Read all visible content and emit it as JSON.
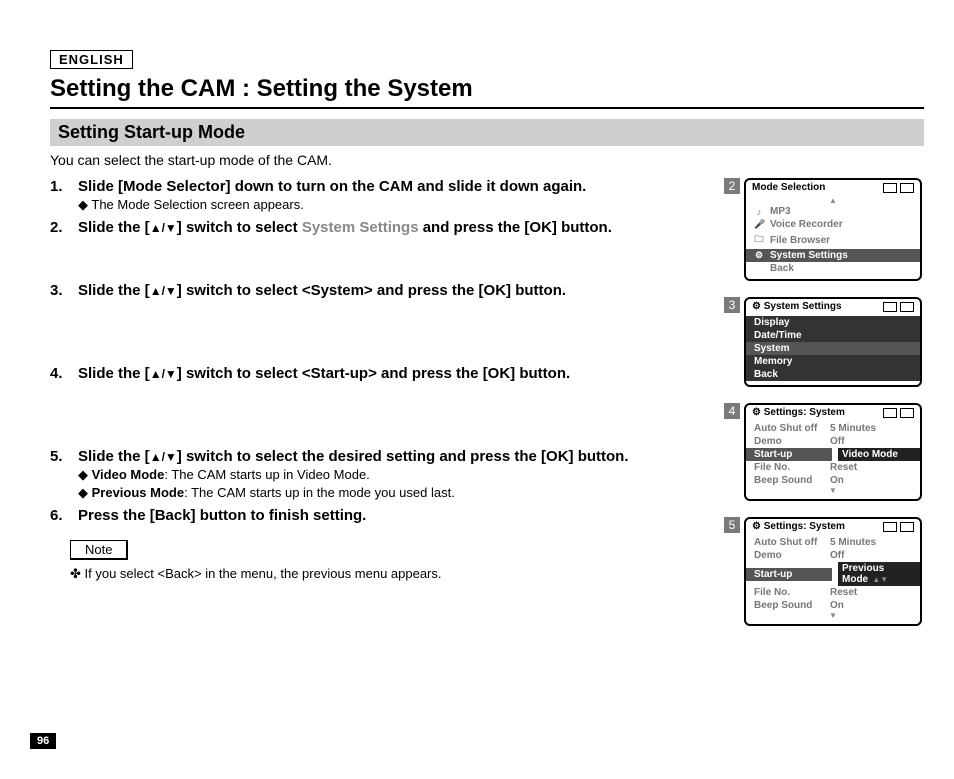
{
  "lang": "ENGLISH",
  "title": "Setting the CAM : Setting the System",
  "section": "Setting Start-up Mode",
  "intro": "You can select the start-up mode of the CAM.",
  "steps": {
    "s1": {
      "num": "1.",
      "head": "Slide [Mode Selector] down to turn on the CAM and slide it down again.",
      "sub1": "The Mode Selection screen appears."
    },
    "s2": {
      "num": "2.",
      "head_a": "Slide the [",
      "head_b": "] switch to select ",
      "head_grey": "System Settings",
      "head_c": " and press the [OK] button."
    },
    "s3": {
      "num": "3.",
      "head_a": "Slide the [",
      "head_b": "] switch to select <System> and press the [OK] button."
    },
    "s4": {
      "num": "4.",
      "head_a": "Slide the [",
      "head_b": "] switch to select <Start-up> and press the [OK] button."
    },
    "s5": {
      "num": "5.",
      "head_a": "Slide the [",
      "head_b": "] switch to select the desired setting and press the [OK] button.",
      "sub1_b": "Video Mode",
      "sub1_t": ": The CAM starts up in Video Mode.",
      "sub2_b": "Previous Mode",
      "sub2_t": ": The CAM starts up in the mode you used last."
    },
    "s6": {
      "num": "6.",
      "head": "Press the [Back] button to finish setting."
    }
  },
  "note_label": "Note",
  "note_text": "If you select <Back> in the menu, the previous menu appears.",
  "page_num": "96",
  "screens": {
    "sc2": {
      "num": "2",
      "title": "Mode Selection",
      "items": {
        "a": "MP3",
        "b": "Voice Recorder",
        "c": "File Browser",
        "d": "System Settings",
        "e": "Back"
      }
    },
    "sc3": {
      "num": "3",
      "title": "System Settings",
      "items": {
        "a": "Display",
        "b": "Date/Time",
        "c": "System",
        "d": "Memory",
        "e": "Back"
      }
    },
    "sc4": {
      "num": "4",
      "title": "Settings: System",
      "rows": {
        "r1": {
          "k": "Auto Shut off",
          "v": "5 Minutes"
        },
        "r2": {
          "k": "Demo",
          "v": "Off"
        },
        "r3": {
          "k": "Start-up",
          "v": "Video Mode"
        },
        "r4": {
          "k": "File No.",
          "v": "Reset"
        },
        "r5": {
          "k": "Beep Sound",
          "v": "On"
        }
      }
    },
    "sc5": {
      "num": "5",
      "title": "Settings: System",
      "rows": {
        "r1": {
          "k": "Auto Shut off",
          "v": "5 Minutes"
        },
        "r2": {
          "k": "Demo",
          "v": "Off"
        },
        "r3": {
          "k": "Start-up",
          "v": "Previous Mode"
        },
        "r4": {
          "k": "File No.",
          "v": "Reset"
        },
        "r5": {
          "k": "Beep Sound",
          "v": "On"
        }
      }
    }
  }
}
